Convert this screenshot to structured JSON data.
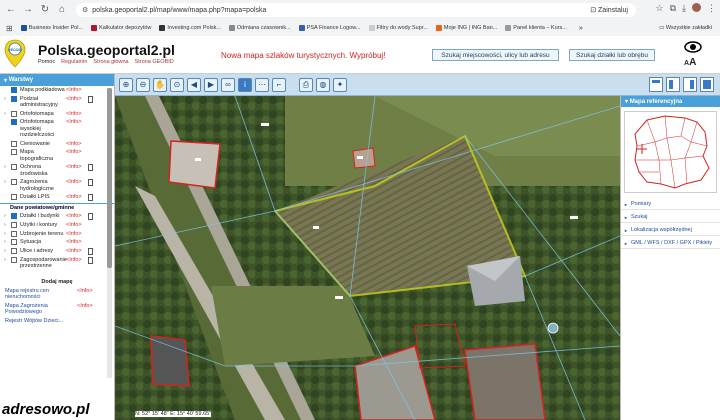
{
  "browser": {
    "url": "polska.geoportal2.pl/map/www/mapa.php?mapa=polska",
    "install_label": "Zainstaluj",
    "bookmarks": [
      {
        "label": "Business Insider Pol...",
        "color": "#1a4fa3"
      },
      {
        "label": "Kalkulator depozytów",
        "color": "#b5122b"
      },
      {
        "label": "Investing.com Polsk...",
        "color": "#333333"
      },
      {
        "label": "Odmiana czasownik...",
        "color": "#888888"
      },
      {
        "label": "PSA Finance Logow...",
        "color": "#3a5ea8"
      },
      {
        "label": "Filtry do wody Supr...",
        "color": "#cccccc"
      },
      {
        "label": "Moje ING | ING Ban...",
        "color": "#e8661a"
      },
      {
        "label": "Panel klienta – Kurs...",
        "color": "#999999"
      }
    ],
    "all_bookmarks": "Wszystkie zakładki"
  },
  "site": {
    "title": "Polska.geoportal2.pl",
    "logo_text": "GEOOID",
    "links": [
      "Pomoc",
      "Regulamin",
      "Strona główna",
      "Strona GEOBID"
    ],
    "promo": "Nowa mapa szlaków turystycznych. Wypróbuj!",
    "search_address": "Szukaj miejscowości, ulicy lub adresu",
    "search_parcel": "Szukaj działki lub obrębu",
    "font_size_label": "A",
    "font_size_label_big": "A"
  },
  "layers_panel": {
    "title": "Warstwy",
    "layers": [
      {
        "name": "Mapa podkładowa",
        "info": "<Info>",
        "checked": true,
        "expand": false,
        "doc": false
      },
      {
        "name": "Podział administracyjny",
        "info": "<Info>",
        "checked": true,
        "expand": true,
        "doc": true
      },
      {
        "name": "Ortofotomapa",
        "info": "<Info>",
        "checked": false,
        "expand": true,
        "doc": false
      },
      {
        "name": "Ortofotomapa wysokiej rozdzielczości",
        "info": "<Info>",
        "checked": true,
        "expand": false,
        "doc": false
      },
      {
        "name": "Cieniowanie",
        "info": "<Info>",
        "checked": false,
        "expand": false,
        "doc": false
      },
      {
        "name": "Mapa topograficzna",
        "info": "<Info>",
        "checked": false,
        "expand": false,
        "doc": false
      },
      {
        "name": "Ochrona środowiska",
        "info": "<Info>",
        "checked": false,
        "expand": true,
        "doc": true
      },
      {
        "name": "Zagrożenia hydrologiczne",
        "info": "<Info>",
        "checked": false,
        "expand": true,
        "doc": true
      },
      {
        "name": "Działki LPIS",
        "info": "<Info>",
        "checked": false,
        "expand": false,
        "doc": true
      }
    ],
    "section": "Dane powiatowe/gminne",
    "section_layers": [
      {
        "name": "Działki i budynki",
        "info": "<Info>",
        "checked": true,
        "expand": true,
        "doc": true
      },
      {
        "name": "Użytki i kontury",
        "info": "<Info>",
        "checked": false,
        "expand": true,
        "doc": false
      },
      {
        "name": "Uzbrojenie terenu",
        "info": "<Info>",
        "checked": false,
        "expand": true,
        "doc": false
      },
      {
        "name": "Sytuacja",
        "info": "<Info>",
        "checked": false,
        "expand": true,
        "doc": false
      },
      {
        "name": "Ulice i adresy",
        "info": "<Info>",
        "checked": false,
        "expand": true,
        "doc": true
      },
      {
        "name": "Zagospodarowanie przestrzenne",
        "info": "<Info>",
        "checked": false,
        "expand": true,
        "doc": true
      }
    ],
    "add_map": "Dodaj mapę",
    "map_links": [
      {
        "label": "Mapa rejestru cen nieruchomości",
        "info": "<Info>"
      },
      {
        "label": "Mapa Zagrożenia Powodziowego",
        "info": "<Info>"
      },
      {
        "label": "Rejestr Wójtów Dzieci...",
        "info": ""
      }
    ]
  },
  "reference_panel": {
    "title": "Mapa referencyjna",
    "links": [
      "Pomiary",
      "Szukaj",
      "Lokalizacja współrzędnej",
      "GML / WFS / DXF / GPX / Pikiety"
    ]
  },
  "status": {
    "coords": "N: 52° 15' 48\"   E: 15° 40' 59.65\""
  },
  "watermark": "adresowo.pl"
}
